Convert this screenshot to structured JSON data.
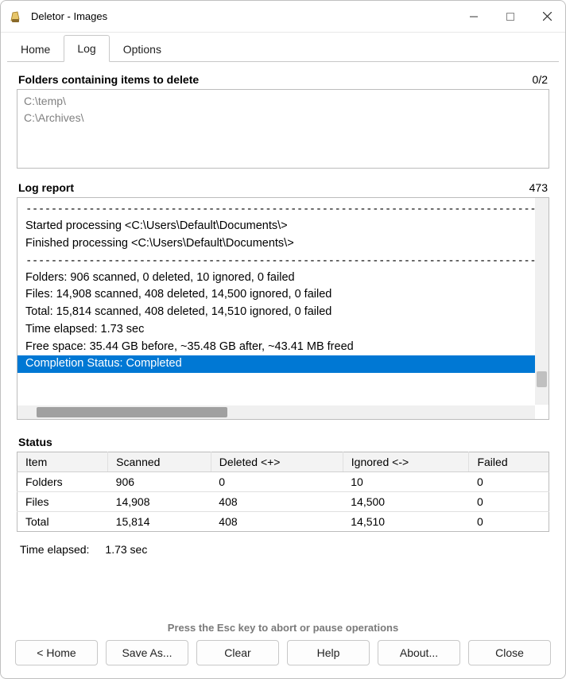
{
  "window": {
    "title": "Deletor - Images"
  },
  "tabs": {
    "home": "Home",
    "log": "Log",
    "options": "Options",
    "active": "log"
  },
  "folders_section": {
    "title": "Folders containing items to delete",
    "count": "0/2",
    "items": [
      "C:\\temp\\",
      "C:\\Archives\\"
    ]
  },
  "log_section": {
    "title": "Log report",
    "count": "473",
    "separator": "---------------------------------------------------------------------------------------------",
    "lines": {
      "l1": "Started processing <C:\\Users\\Default\\Documents\\>",
      "l2": "Finished processing <C:\\Users\\Default\\Documents\\>",
      "l3": "Folders: 906 scanned, 0 deleted, 10 ignored, 0 failed",
      "l4": "Files: 14,908 scanned, 408 deleted, 14,500 ignored, 0 failed",
      "l5": "Total: 15,814 scanned, 408 deleted, 14,510 ignored, 0 failed",
      "l6": "Time elapsed: 1.73 sec",
      "l7": "Free space: 35.44 GB before, ~35.48 GB after, ~43.41 MB freed",
      "l8": "Completion Status: Completed"
    }
  },
  "status_section": {
    "title": "Status",
    "headers": {
      "item": "Item",
      "scanned": "Scanned",
      "deleted": "Deleted <+>",
      "ignored": "Ignored <->",
      "failed": "Failed"
    },
    "rows": {
      "folders": {
        "label": "Folders",
        "scanned": "906",
        "deleted": "0",
        "ignored": "10",
        "failed": "0"
      },
      "files": {
        "label": "Files",
        "scanned": "14,908",
        "deleted": "408",
        "ignored": "14,500",
        "failed": "0"
      },
      "total": {
        "label": "Total",
        "scanned": "15,814",
        "deleted": "408",
        "ignored": "14,510",
        "failed": "0"
      }
    }
  },
  "time_elapsed": {
    "label": "Time elapsed:",
    "value": "1.73 sec"
  },
  "hint": "Press the Esc key to abort or pause operations",
  "buttons": {
    "home": "< Home",
    "save_as": "Save As...",
    "clear": "Clear",
    "help": "Help",
    "about": "About...",
    "close": "Close"
  }
}
